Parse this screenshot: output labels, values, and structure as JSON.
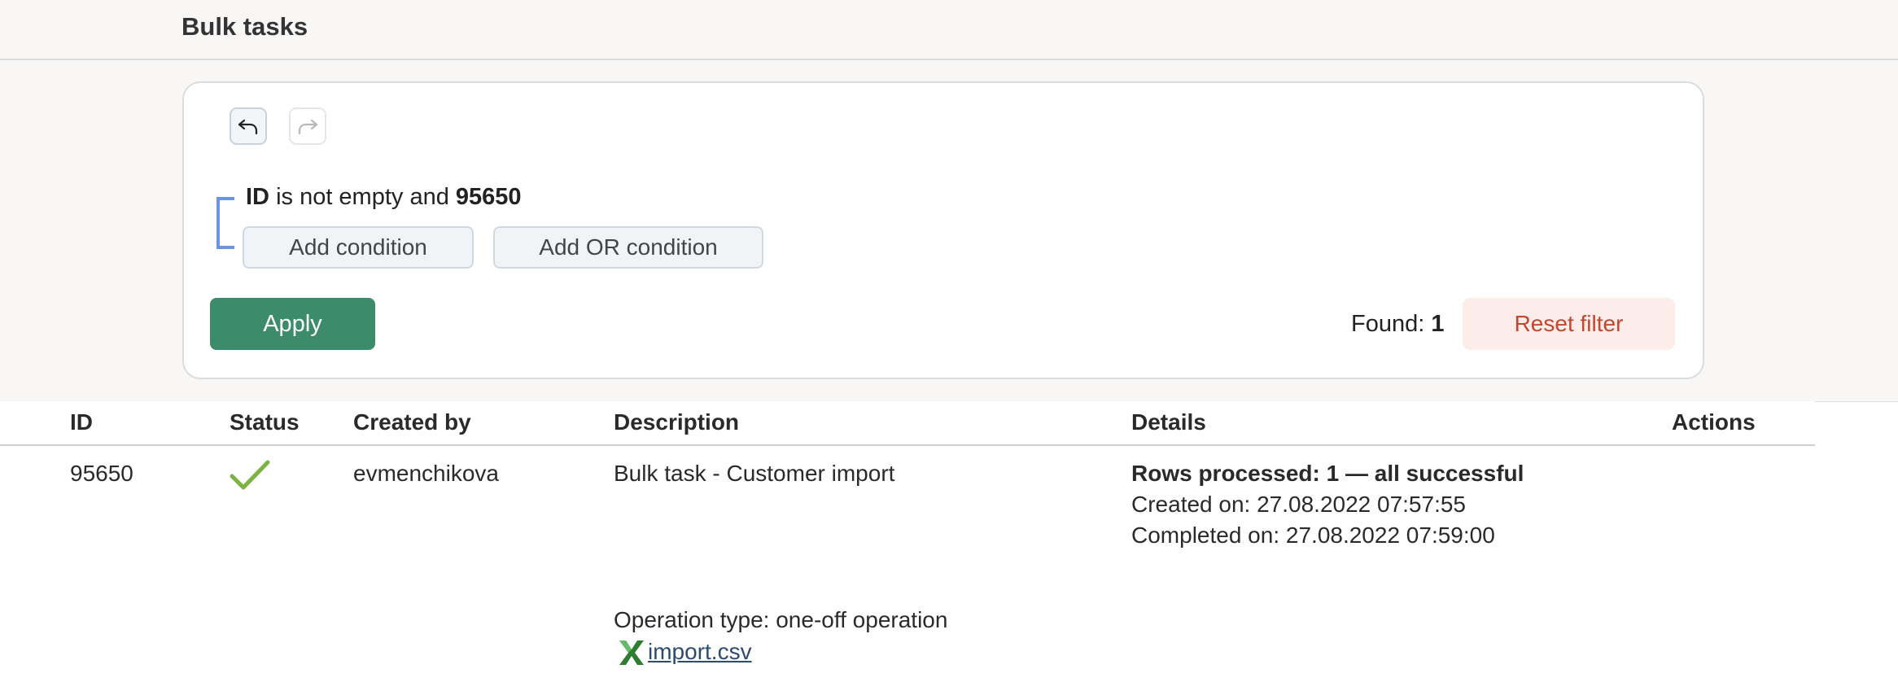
{
  "header": {
    "title": "Bulk tasks"
  },
  "filter": {
    "undo_icon": "undo-arrow-icon",
    "redo_icon": "redo-arrow-icon",
    "condition": {
      "field": "ID",
      "operator_text": "is not empty and",
      "value": "95650"
    },
    "add_condition_label": "Add condition",
    "add_or_condition_label": "Add OR condition",
    "apply_label": "Apply",
    "found_label": "Found:",
    "found_count": "1",
    "reset_label": "Reset filter",
    "colors": {
      "apply_bg": "#3c8c6c",
      "reset_bg": "#fcecea",
      "reset_text": "#c4462c",
      "bracket": "#6e93e6"
    }
  },
  "table": {
    "columns": [
      "ID",
      "Status",
      "Created by",
      "Description",
      "Details",
      "Actions"
    ],
    "rows": [
      {
        "id": "95650",
        "status_icon": "checkmark-icon",
        "status_color": "#7cb342",
        "created_by": "evmenchikova",
        "description": "Bulk task - Customer import",
        "details": {
          "rows_processed": "Rows processed: 1 — all successful",
          "created_on": "Created on: 27.08.2022 07:57:55",
          "completed_on": "Completed on: 27.08.2022 07:59:00"
        },
        "operation_type": "Operation type: one-off operation",
        "file_icon": "excel-icon",
        "file_name": "import.csv"
      }
    ]
  }
}
